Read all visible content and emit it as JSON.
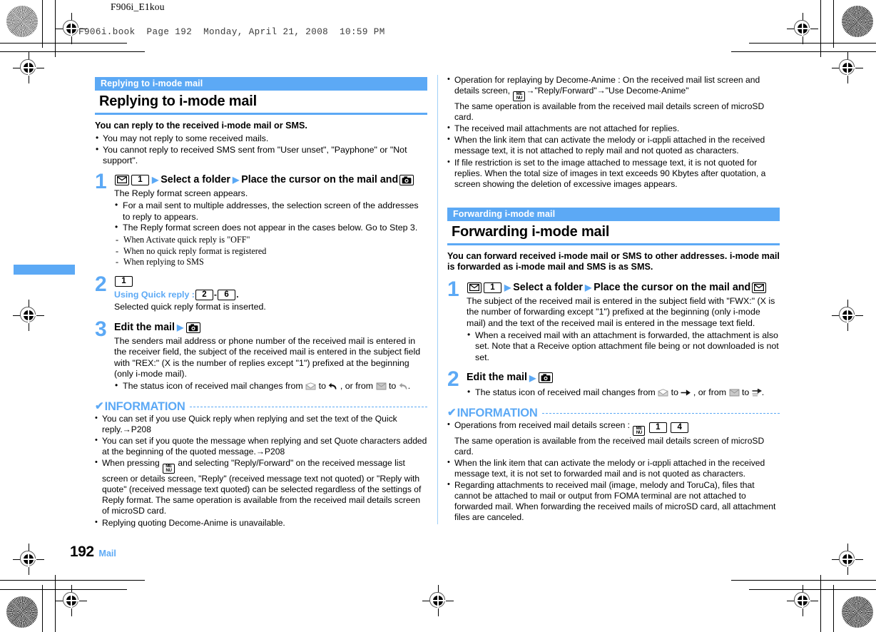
{
  "meta": {
    "doc_label": "F906i_E1kou",
    "book_line": "F906i.book  Page 192  Monday, April 21, 2008  10:59 PM"
  },
  "footer": {
    "page_number": "192",
    "chapter": "Mail"
  },
  "colors": {
    "accent": "#5CA9F5",
    "text": "#000000",
    "page": "#FFFFFF"
  },
  "left_column": {
    "section": {
      "bar_label": "Replying to i-mode mail",
      "title": "Replying to i-mode mail"
    },
    "lead": "You can reply to the received i-mode mail or SMS.",
    "lead_bullets": [
      "You may not reply to some received mails.",
      "You cannot reply to received SMS sent from \"User unset\", \"Payphone\" or \"Not support\"."
    ],
    "steps": [
      {
        "number": "1",
        "head_parts": [
          "envelope-key",
          "key-1",
          "triangle",
          "Select a folder",
          "triangle",
          "Place the cursor on the mail and ",
          "camera-key"
        ],
        "head_text_1": "Select a folder",
        "head_text_2": "Place the cursor on the mail and",
        "body": "The Reply format screen appears.",
        "bullets": [
          "For a mail sent to multiple addresses, the selection screen of the addresses to reply to appears.",
          "The Reply format screen does not appear in the cases below. Go to Step 3."
        ],
        "dash_items": [
          "When Activate quick reply is \"OFF\"",
          "When no quick reply format is registered",
          "When replying to SMS"
        ]
      },
      {
        "number": "2",
        "head_key": "1",
        "subnote_label": "Using Quick reply : ",
        "subnote_key_from": "2",
        "subnote_dash": "-",
        "subnote_key_to": "6",
        "subnote_period": ".",
        "body": "Selected quick reply format is inserted."
      },
      {
        "number": "3",
        "head_text": "Edit the mail",
        "head_key_icon": "camera-key",
        "body": "The senders mail address or phone number of the received mail is entered in the receiver field, the subject of the received mail is entered in the subject field with \"REX:\" (X is the number of replies except \"1\") prefixed at the beginning (only i-mode mail).",
        "status_bullet": {
          "text_a": "The status icon of received mail changes from",
          "text_to1": "to",
          "text_b": ", or from",
          "text_to2": "to",
          "text_end": "."
        }
      }
    ],
    "information": {
      "heading": "INFORMATION",
      "items": [
        "You can set if you use Quick reply when replying and set the text of the Quick reply.→P208",
        "You can set if you quote the message when replying and set Quote characters added at the beginning of the quoted message.→P208",
        "When pressing [MENU] and selecting \"Reply/Forward\" on the received message list screen or details screen, \"Reply\" (received message text not quoted) or \"Reply with quote\" (received message text quoted) can be selected regardless of the settings of Reply format. The same operation is available from the received mail details screen of microSD card.",
        "Replying quoting Decome-Anime is unavailable."
      ],
      "item3_pre": "When pressing",
      "item3_post": "and selecting \"Reply/Forward\" on the received message list screen or details screen, \"Reply\" (received message text not quoted) or \"Reply with quote\" (received message text quoted) can be selected regardless of the settings of Reply format. The same operation is available from the received mail details screen of microSD card."
    }
  },
  "right_column": {
    "top_bullets": {
      "item1_pre": "Operation for replaying by Decome-Anime : On the received mail list screen and details screen,",
      "item1_post": "→\"Reply/Forward\"→\"Use Decome-Anime\"",
      "item1_line3": "The same operation is available from the received mail details screen of microSD card.",
      "item2": "The received mail attachments are not attached for replies.",
      "item3": "When the link item that can activate the melody or i-αppli attached in the received message text, it is not attached to reply mail and not quoted as characters.",
      "item4": "If file restriction is set to the image attached to message text, it is not quoted for replies. When the total size of images in text exceeds 90 Kbytes after quotation, a screen showing the deletion of excessive images appears."
    },
    "section": {
      "bar_label": "Forwarding i-mode mail",
      "title": "Forwarding i-mode mail"
    },
    "lead": "You can forward received i-mode mail or SMS to other addresses. i-mode mail is forwarded as i-mode mail and SMS is as SMS.",
    "steps": [
      {
        "number": "1",
        "head_text_1": "Select a folder",
        "head_text_2": "Place the cursor on the mail and",
        "body": "The subject of the received mail is entered in the subject field with \"FWX:\" (X is the number of forwarding except \"1\") prefixed at the beginning (only i-mode mail) and the text of the received mail is entered in the message text field.",
        "bullets": [
          "When a received mail with an attachment is forwarded, the attachment is also set. Note that a Receive option attachment file being or not downloaded is not set."
        ]
      },
      {
        "number": "2",
        "head_text": "Edit the mail",
        "head_key_icon": "camera-key",
        "status_bullet": {
          "text_a": "The status icon of received mail changes from",
          "text_to1": "to",
          "text_b": ", or from",
          "text_to2": "to",
          "text_end": "."
        }
      }
    ],
    "information": {
      "heading": "INFORMATION",
      "item1_pre": "Operations from received mail details screen :",
      "item1_keys": [
        "MENU",
        "1",
        "4"
      ],
      "item1_line2": "The same operation is available from the received mail details screen of microSD card.",
      "item2": "When the link item that can activate the melody or i-αppli attached in the received message text, it is not set to forwarded mail and is not quoted as characters.",
      "item3": "Regarding attachments to received mail (image, melody and ToruCa), files that cannot be attached to mail or output from FOMA terminal are not attached to forwarded mail. When forwarding the received mails of microSD card, all attachment files are canceled."
    }
  },
  "keys": {
    "num1": "1",
    "num2": "2",
    "num4": "4",
    "num6": "6",
    "menu_top": "ME",
    "menu_bottom": "NU"
  }
}
